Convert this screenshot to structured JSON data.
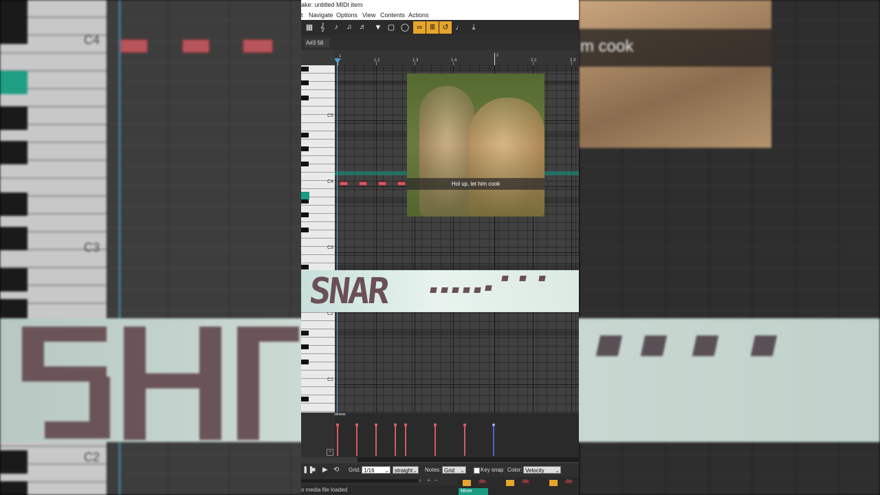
{
  "window": {
    "title": "ake: untitled MIDI item"
  },
  "menu": {
    "items": [
      "t",
      "Navigate",
      "Options",
      "View",
      "Contents",
      "Actions"
    ]
  },
  "toolbar": {
    "icons": [
      "grid-icon",
      "key-icon",
      "note-icon",
      "note-insert-icon",
      "note-erase-icon",
      "filter-icon",
      "rectangle-icon",
      "loop-icon",
      "chord-icon",
      "bars-icon",
      "reverse-icon",
      "step-icon",
      "download-icon"
    ]
  },
  "note_info": {
    "label": "A#3  58"
  },
  "ruler": {
    "labels": [
      "1",
      "1.2",
      "1.3",
      "1.4",
      "2",
      "2.2",
      "2.3"
    ]
  },
  "keyboard": {
    "labels": [
      "C5",
      "C4",
      "C3",
      "C2",
      "C1"
    ]
  },
  "meme": {
    "caption": "Hol up, let him cook"
  },
  "overlay": {
    "word": "SNAR"
  },
  "velocity_lane": {
    "velocities": [
      0.75,
      0.75,
      0.75,
      0.75,
      0.75,
      0.75,
      0.75,
      0.75
    ]
  },
  "bottom": {
    "grid_label": "Grid:",
    "grid_value": "1/16",
    "swing_value": "straight",
    "notes_label": "Notes:",
    "notes_value": "Grid",
    "keysnap_label": "Key snap",
    "color_label": "Color:",
    "color_value": "Velocity"
  },
  "status": {
    "text": "o media file loaded"
  },
  "mixer": {
    "tab_label": "Mixer",
    "values": [
      "-56-",
      "-56-",
      "-56-"
    ]
  },
  "background": {
    "keyboard_labels": [
      "C4",
      "C3",
      "C2"
    ],
    "caption_fragment": "m cook"
  },
  "colors": {
    "note": "#d45b63",
    "accent": "#e7a52b",
    "teal": "#1a9c82",
    "playhead": "#4fa3d1"
  }
}
